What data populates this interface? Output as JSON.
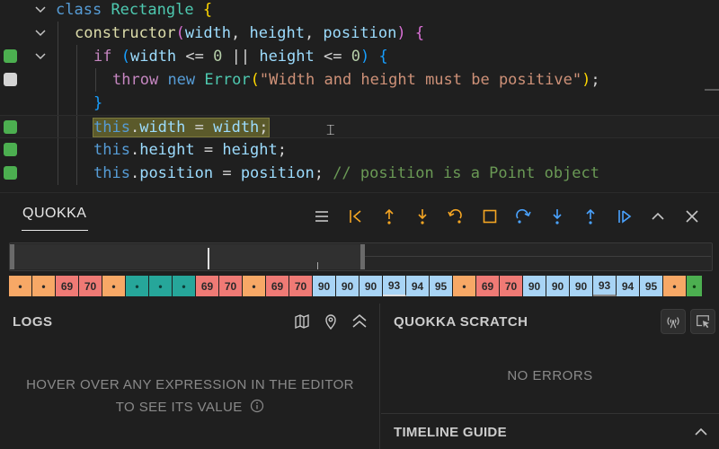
{
  "editor": {
    "lines": [
      {
        "marker": "",
        "fold": true,
        "indent": 0,
        "tokens": [
          [
            "kw",
            "class"
          ],
          [
            "pun",
            " "
          ],
          [
            "cls",
            "Rectangle"
          ],
          [
            "pun",
            " "
          ],
          [
            "brk1",
            "{"
          ]
        ]
      },
      {
        "marker": "",
        "fold": true,
        "indent": 1,
        "tokens": [
          [
            "fn",
            "constructor"
          ],
          [
            "brk2",
            "("
          ],
          [
            "prm",
            "width"
          ],
          [
            "pun",
            ", "
          ],
          [
            "prm",
            "height"
          ],
          [
            "pun",
            ", "
          ],
          [
            "prm",
            "position"
          ],
          [
            "brk2",
            ")"
          ],
          [
            "pun",
            " "
          ],
          [
            "brk2",
            "{"
          ]
        ]
      },
      {
        "marker": "green",
        "fold": true,
        "indent": 2,
        "tokens": [
          [
            "kw2",
            "if"
          ],
          [
            "pun",
            " "
          ],
          [
            "brk3",
            "("
          ],
          [
            "prm",
            "width"
          ],
          [
            "pun",
            " <= "
          ],
          [
            "num",
            "0"
          ],
          [
            "pun",
            " || "
          ],
          [
            "prm",
            "height"
          ],
          [
            "pun",
            " <= "
          ],
          [
            "num",
            "0"
          ],
          [
            "brk3",
            ")"
          ],
          [
            "pun",
            " "
          ],
          [
            "brk3",
            "{"
          ]
        ]
      },
      {
        "marker": "gray",
        "fold": false,
        "indent": 3,
        "tokens": [
          [
            "kw2",
            "throw"
          ],
          [
            "pun",
            " "
          ],
          [
            "kw",
            "new"
          ],
          [
            "pun",
            " "
          ],
          [
            "cls",
            "Error"
          ],
          [
            "brk1",
            "("
          ],
          [
            "str",
            "\"Width and height must be positive\""
          ],
          [
            "brk1",
            ")"
          ],
          [
            "pun",
            ";"
          ]
        ]
      },
      {
        "marker": "",
        "fold": false,
        "indent": 2,
        "tokens": [
          [
            "brk3",
            "}"
          ]
        ]
      },
      {
        "marker": "green",
        "fold": false,
        "indent": 2,
        "current": true,
        "tokens": [
          [
            "kw",
            "this"
          ],
          [
            "pun",
            "."
          ],
          [
            "prm",
            "width"
          ],
          [
            "pun",
            " = "
          ],
          [
            "prm",
            "width"
          ],
          [
            "pun",
            ";"
          ]
        ]
      },
      {
        "marker": "green",
        "fold": false,
        "indent": 2,
        "tokens": [
          [
            "kw",
            "this"
          ],
          [
            "pun",
            "."
          ],
          [
            "prm",
            "height"
          ],
          [
            "pun",
            " = "
          ],
          [
            "prm",
            "height"
          ],
          [
            "pun",
            ";"
          ]
        ]
      },
      {
        "marker": "green",
        "fold": false,
        "indent": 2,
        "tokens": [
          [
            "kw",
            "this"
          ],
          [
            "pun",
            "."
          ],
          [
            "prm",
            "position"
          ],
          [
            "pun",
            " = "
          ],
          [
            "prm",
            "position"
          ],
          [
            "pun",
            "; "
          ],
          [
            "cmt",
            "// position is a Point object"
          ]
        ]
      }
    ]
  },
  "panel": {
    "tab_label": "QUOKKA",
    "tools": [
      {
        "name": "list-icon",
        "color": "#c5c5c5"
      },
      {
        "name": "step-back-start-icon",
        "color": "#f5a623"
      },
      {
        "name": "step-out-back-icon",
        "color": "#f5a623"
      },
      {
        "name": "step-into-back-icon",
        "color": "#f5a623"
      },
      {
        "name": "step-over-back-icon",
        "color": "#f5a623"
      },
      {
        "name": "stop-icon",
        "color": "#f5a623"
      },
      {
        "name": "step-over-icon",
        "color": "#4aa3ff"
      },
      {
        "name": "step-into-icon",
        "color": "#4aa3ff"
      },
      {
        "name": "step-out-icon",
        "color": "#4aa3ff"
      },
      {
        "name": "continue-icon",
        "color": "#4aa3ff"
      },
      {
        "name": "chevron-up-icon",
        "color": "#c5c5c5"
      },
      {
        "name": "close-icon",
        "color": "#c5c5c5"
      }
    ]
  },
  "timeline": {
    "cells": [
      {
        "label": "•",
        "kind": "orange"
      },
      {
        "label": "•",
        "kind": "orange"
      },
      {
        "label": "69",
        "kind": "red"
      },
      {
        "label": "70",
        "kind": "red"
      },
      {
        "label": "•",
        "kind": "orange"
      },
      {
        "label": "•",
        "kind": "teal"
      },
      {
        "label": "•",
        "kind": "teal"
      },
      {
        "label": "•",
        "kind": "teal"
      },
      {
        "label": "69",
        "kind": "red"
      },
      {
        "label": "70",
        "kind": "red"
      },
      {
        "label": "•",
        "kind": "orange"
      },
      {
        "label": "69",
        "kind": "red"
      },
      {
        "label": "70",
        "kind": "red"
      },
      {
        "label": "90",
        "kind": "blue"
      },
      {
        "label": "90",
        "kind": "blue"
      },
      {
        "label": "90",
        "kind": "blue"
      },
      {
        "label": "93",
        "kind": "blue",
        "state": "active"
      },
      {
        "label": "94",
        "kind": "blue"
      },
      {
        "label": "95",
        "kind": "blue"
      },
      {
        "label": "•",
        "kind": "orange"
      },
      {
        "label": "69",
        "kind": "red"
      },
      {
        "label": "70",
        "kind": "red"
      },
      {
        "label": "90",
        "kind": "blue"
      },
      {
        "label": "90",
        "kind": "blue"
      },
      {
        "label": "90",
        "kind": "blue"
      },
      {
        "label": "93",
        "kind": "blue",
        "state": "active2"
      },
      {
        "label": "94",
        "kind": "blue"
      },
      {
        "label": "95",
        "kind": "blue"
      },
      {
        "label": "•",
        "kind": "orange"
      },
      {
        "label": "•",
        "kind": "green"
      }
    ]
  },
  "logs": {
    "title": "LOGS",
    "message_line1": "HOVER OVER ANY EXPRESSION IN THE EDITOR",
    "message_line2": "TO SEE ITS VALUE"
  },
  "scratch": {
    "title": "QUOKKA SCRATCH",
    "empty": "NO ERRORS",
    "guide_title": "TIMELINE GUIDE"
  }
}
